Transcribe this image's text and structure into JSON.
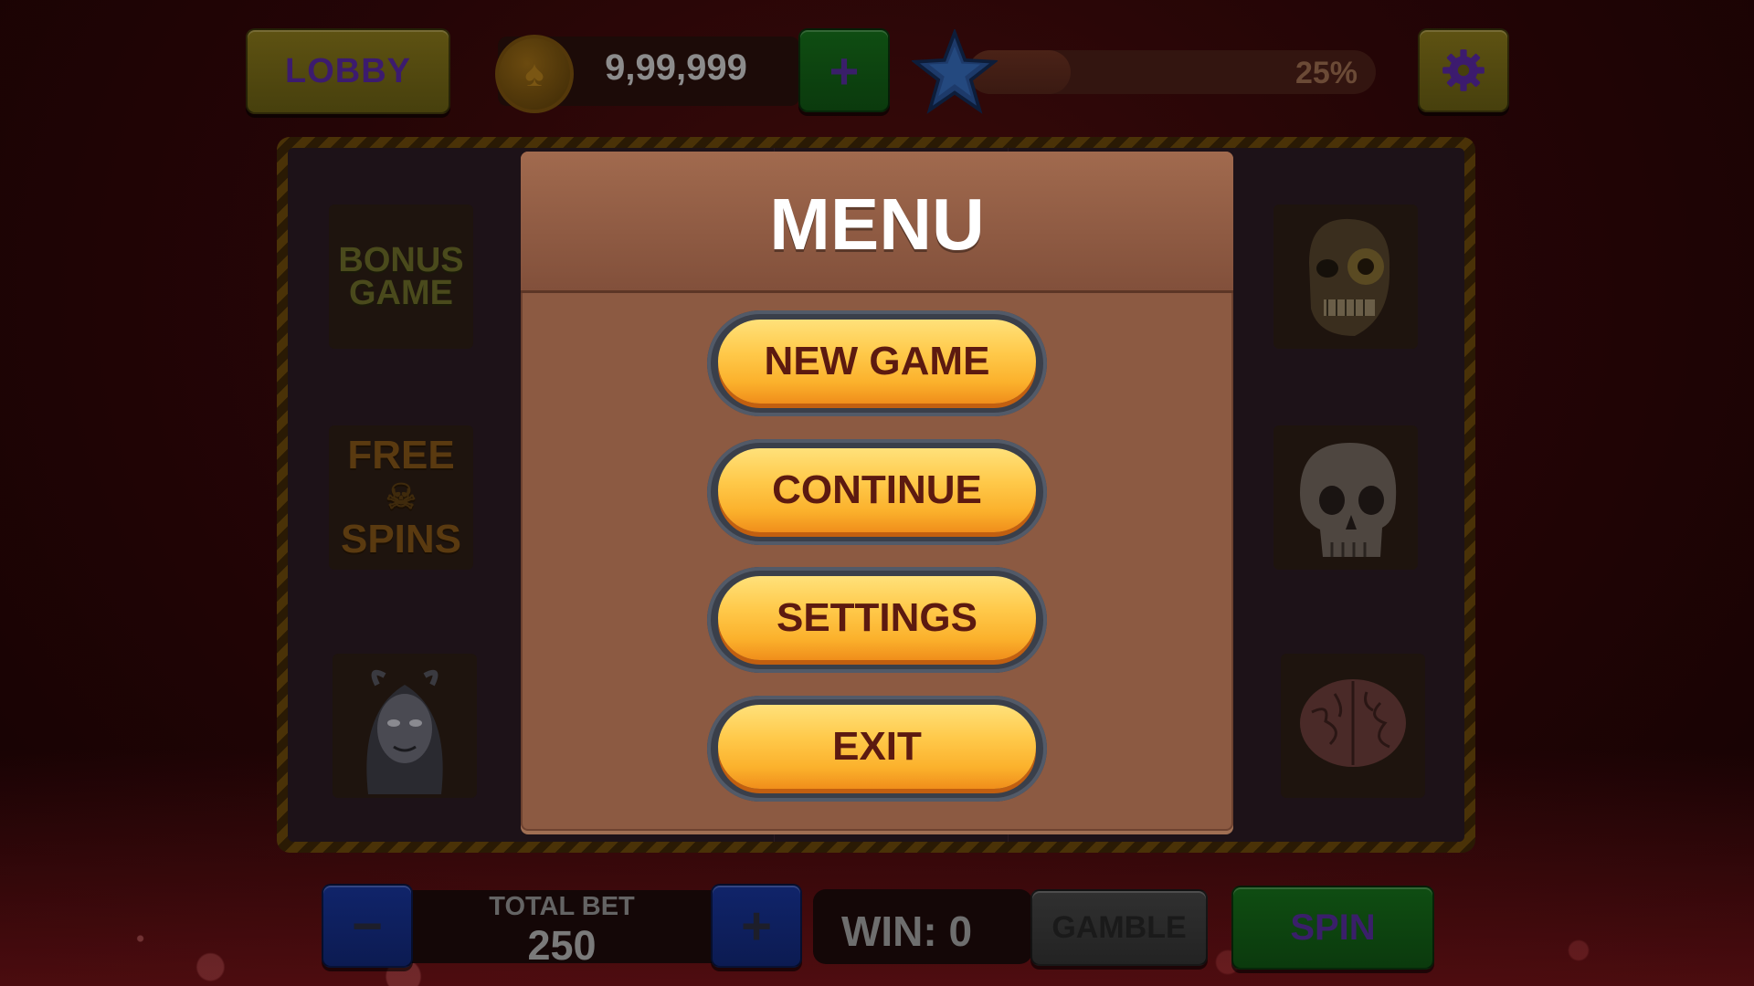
{
  "top_bar": {
    "lobby_label": "LOBBY",
    "coins": "9,99,999",
    "add_coins_label": "+",
    "xp_percent_text": "25%",
    "xp_progress": 0.25
  },
  "reels": {
    "left_symbols": [
      "BONUS GAME",
      "FREE SPINS",
      "witch"
    ],
    "left_text": {
      "bonus_line1": "BONUS",
      "bonus_line2": "GAME",
      "free_line1": "FREE",
      "free_line2": "SPINS"
    },
    "right_symbols": [
      "zombie-head",
      "skull",
      "brain"
    ]
  },
  "menu": {
    "title": "MENU",
    "items": [
      {
        "label": "NEW GAME"
      },
      {
        "label": "CONTINUE"
      },
      {
        "label": "SETTINGS"
      },
      {
        "label": "EXIT"
      }
    ]
  },
  "bottom_bar": {
    "minus_label": "−",
    "total_bet_label": "TOTAL BET",
    "total_bet_value": "250",
    "plus_label": "+",
    "win_text": "WIN: 0",
    "gamble_label": "GAMBLE",
    "spin_label": "SPIN"
  },
  "colors": {
    "menu_bg": "#8c5a42",
    "button_orange": "#fbb12c",
    "button_text": "#5c1a10"
  }
}
